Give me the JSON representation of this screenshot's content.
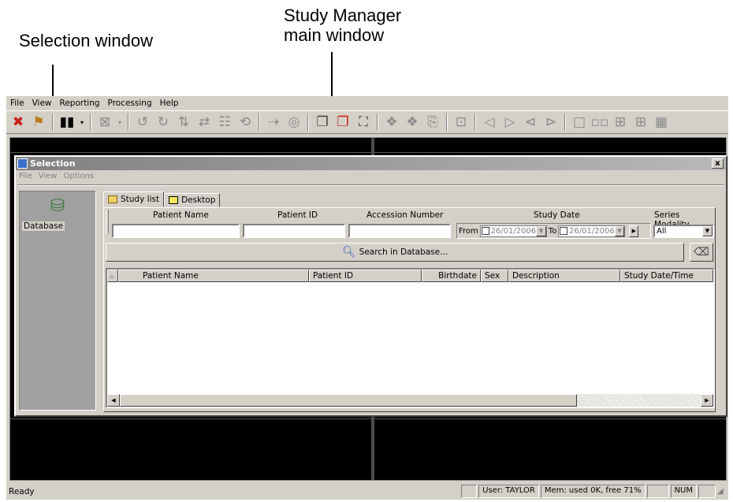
{
  "annotations": {
    "selection_window": "Selection window",
    "study_manager_line1": "Study Manager",
    "study_manager_line2": "main window"
  },
  "menubar": [
    "File",
    "View",
    "Reporting",
    "Processing",
    "Help"
  ],
  "statusbar": {
    "ready": "Ready",
    "user": "User: TAYLOR",
    "memory": "Mem: used 0K, free 71%",
    "num": "NUM"
  },
  "selection": {
    "title": "Selection",
    "close": "x",
    "menu": [
      "File",
      "View",
      "Options"
    ],
    "database_label": "Database",
    "tabs": [
      "Study list",
      "Desktop"
    ],
    "labels": {
      "patient_name": "Patient Name",
      "patient_id": "Patient ID",
      "accession": "Accession Number",
      "study_date": "Study Date",
      "series_modality": "Series Modality"
    },
    "date_from_label": "From",
    "date_from_value": "26/01/2006",
    "date_to_label": "To",
    "date_to_value": "26/01/2006",
    "modality_value": "All",
    "search_button": "Search in Database...",
    "columns": [
      "Patient Name",
      "Patient ID",
      "Birthdate",
      "Sex",
      "Description",
      "Study Date/Time"
    ]
  }
}
